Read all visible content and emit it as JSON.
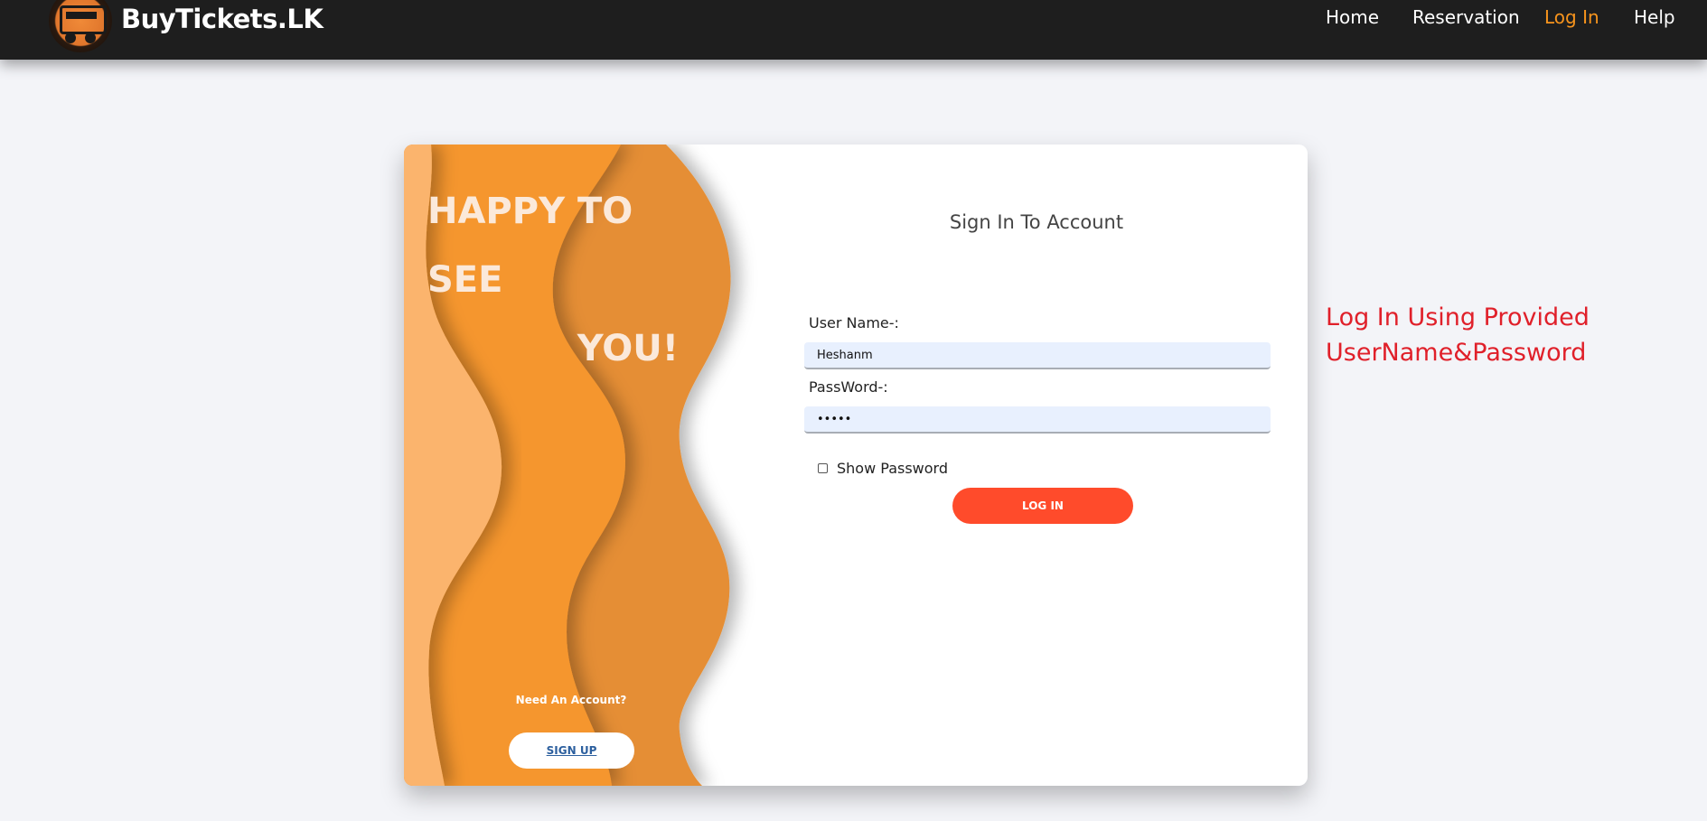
{
  "navbar": {
    "brand": "BuyTickets.LK",
    "links": [
      "Home",
      "Reservation",
      "Log In",
      "Help"
    ],
    "active_link": "Log In",
    "active_color": "#f7941d"
  },
  "welcome_panel": {
    "headline_line1": "HAPPY TO SEE",
    "headline_line2": "YOU!",
    "need_account": "Need An Account?",
    "signup_label": "SIGN UP"
  },
  "login_form": {
    "title": "Sign In To Account",
    "username_label": "User Name-:",
    "username_value": "Heshanm",
    "password_label": "PassWord-:",
    "password_value": "•••••",
    "show_password_label": "Show Password",
    "show_password_checked": false,
    "login_label": "LOG IN",
    "login_color": "#ff4b2b"
  },
  "annotation": {
    "line1": "Log In Using Provided",
    "line2": "UserName&Password",
    "color": "#e0202a"
  }
}
